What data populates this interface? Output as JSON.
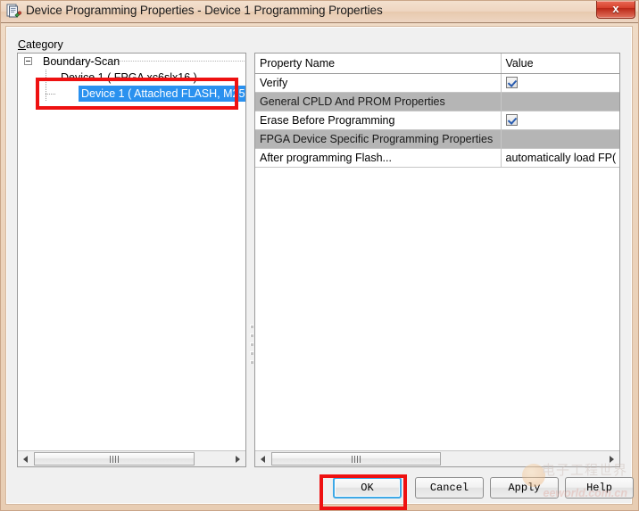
{
  "window": {
    "title": "Device Programming Properties - Device 1 Programming Properties",
    "icon": "document-properties-icon",
    "close_label": "x"
  },
  "category": {
    "label": "Category",
    "accel": "C",
    "rest": "ategory"
  },
  "tree": {
    "items": [
      {
        "label": "Boundary-Scan",
        "level": 0,
        "expanded": true,
        "selected": false
      },
      {
        "label": "Device 1 ( FPGA xc6slx16 )",
        "level": 1,
        "expanded": false,
        "selected": false
      },
      {
        "label": "Device 1 ( Attached FLASH, M25",
        "level": 2,
        "expanded": false,
        "selected": true
      }
    ]
  },
  "properties": {
    "headers": [
      "Property Name",
      "Value"
    ],
    "rows": [
      {
        "name": "Verify",
        "value": "",
        "type": "checkbox",
        "checked": true,
        "section": false
      },
      {
        "name": "General CPLD And PROM Properties",
        "value": "",
        "type": "section",
        "checked": false,
        "section": true
      },
      {
        "name": "Erase Before Programming",
        "value": "",
        "type": "checkbox",
        "checked": true,
        "section": false
      },
      {
        "name": "FPGA Device Specific Programming Properties",
        "value": "",
        "type": "section",
        "checked": false,
        "section": true
      },
      {
        "name": "After programming Flash...",
        "value": "automatically load FP(",
        "type": "text",
        "checked": false,
        "section": false
      }
    ]
  },
  "scrollbars": {
    "left_grip": "||||",
    "right_grip": "||||"
  },
  "buttons": [
    {
      "label": "OK",
      "focused": true,
      "accel": ""
    },
    {
      "label": "Cancel",
      "focused": false,
      "accel": ""
    },
    {
      "label": "Apply",
      "focused": false,
      "accel": "A"
    },
    {
      "label": "Help",
      "focused": false,
      "accel": ""
    }
  ],
  "watermark": {
    "cn": "电子工程世界",
    "en": "eeworld.com.cn"
  },
  "colors": {
    "titlebar": "#eed5c0",
    "selection": "#2a91ef",
    "section_row": "#b5b5b5",
    "annotation": "#ee1111",
    "close_button": "#d5412c",
    "focus_ring": "#3da8e6"
  }
}
